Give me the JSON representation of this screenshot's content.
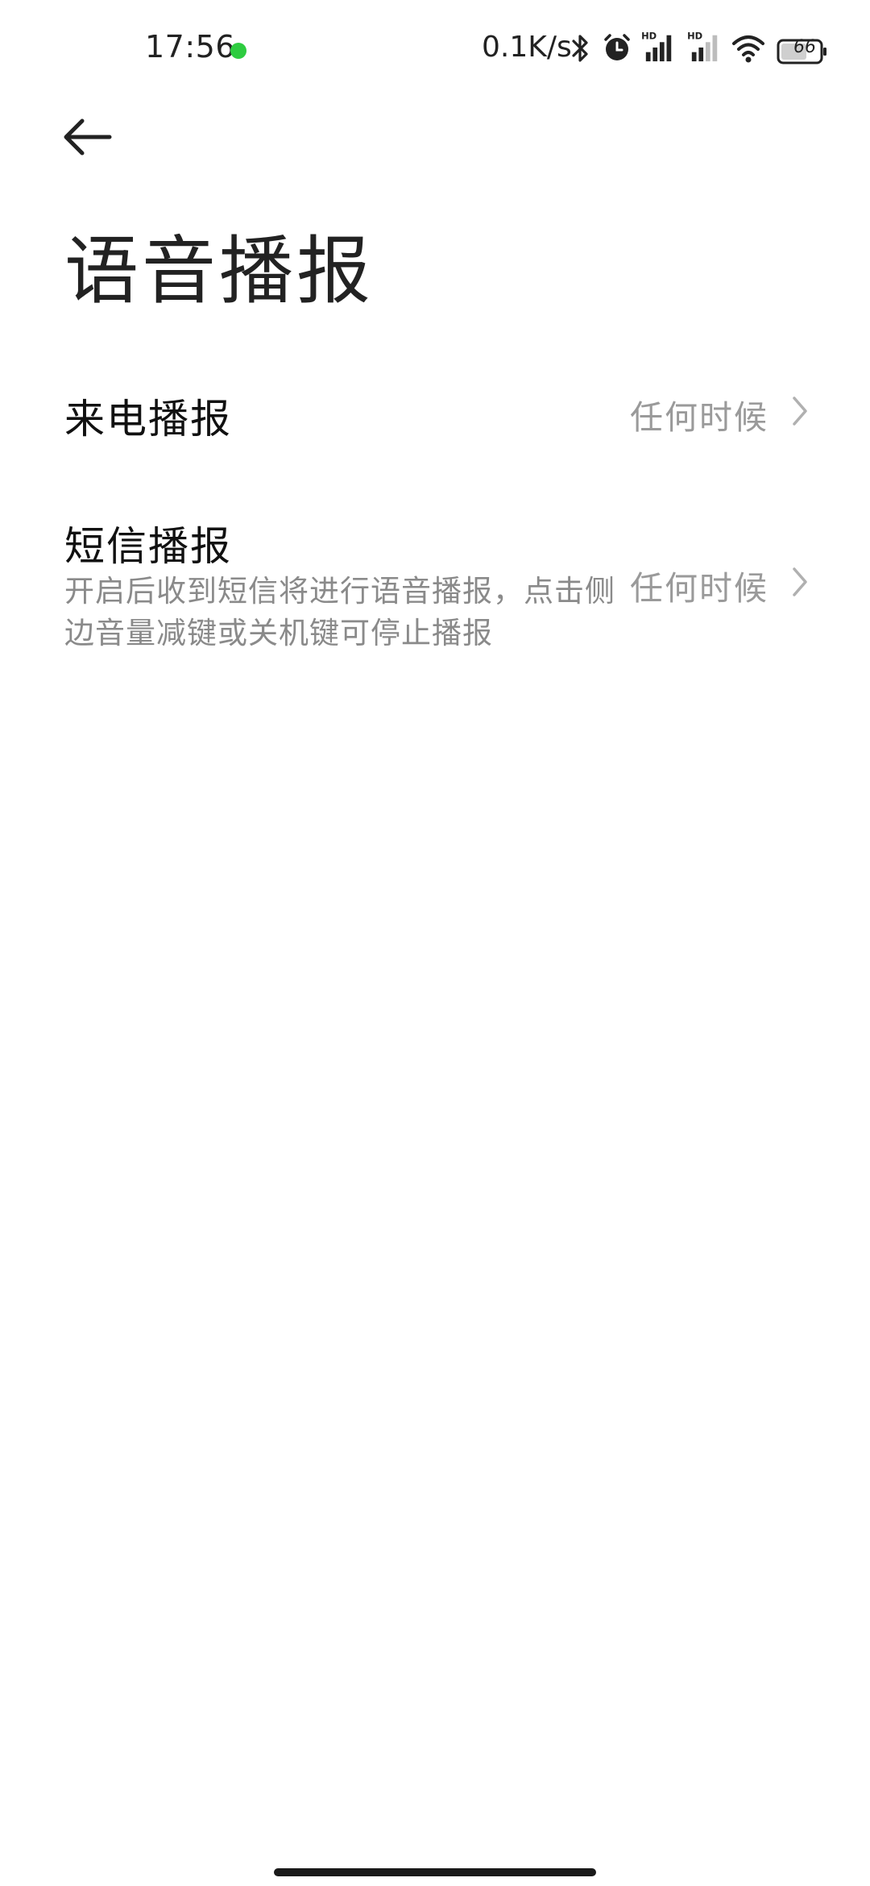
{
  "status_bar": {
    "time": "17:56",
    "net_speed": "0.1K/s",
    "battery": "66",
    "icons": [
      "bluetooth-icon",
      "alarm-icon",
      "hd-signal-icon",
      "hd-signal-icon",
      "wifi-icon",
      "battery-icon"
    ],
    "indicator_color": "#2ecc40"
  },
  "header": {
    "back_icon": "arrow-left-icon",
    "title": "语音播报"
  },
  "settings": {
    "incoming_call": {
      "title": "来电播报",
      "value": "任何时候"
    },
    "sms": {
      "title": "短信播报",
      "description": "开启后收到短信将进行语音播报，点击侧边音量减键或关机键可停止播报",
      "value": "任何时候"
    }
  }
}
